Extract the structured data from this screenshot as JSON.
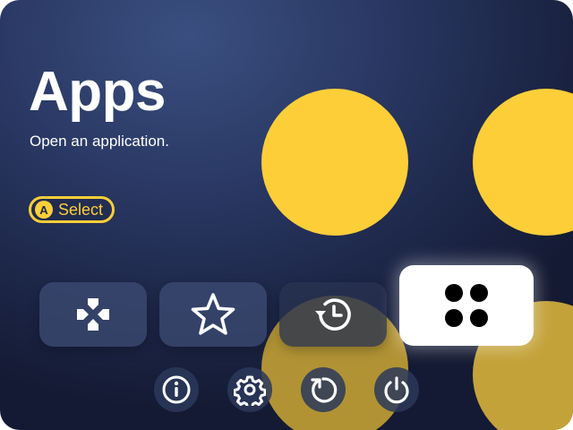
{
  "page": {
    "title": "Apps",
    "subtitle": "Open an application."
  },
  "hint": {
    "button_letter": "A",
    "label": "Select"
  },
  "tiles": [
    {
      "icon": "gamepad-icon",
      "selected": false
    },
    {
      "icon": "star-icon",
      "selected": false
    },
    {
      "icon": "history-icon",
      "selected": false
    },
    {
      "icon": "apps-grid-icon",
      "selected": true
    }
  ],
  "system_buttons": [
    {
      "icon": "info-icon"
    },
    {
      "icon": "settings-icon"
    },
    {
      "icon": "restart-icon"
    },
    {
      "icon": "power-icon"
    }
  ],
  "colors": {
    "accent": "#fdce38",
    "background_dark": "#141a33",
    "background_light": "#3a4f80",
    "tile": "#3e4e76",
    "selected_tile": "#ffffff"
  }
}
